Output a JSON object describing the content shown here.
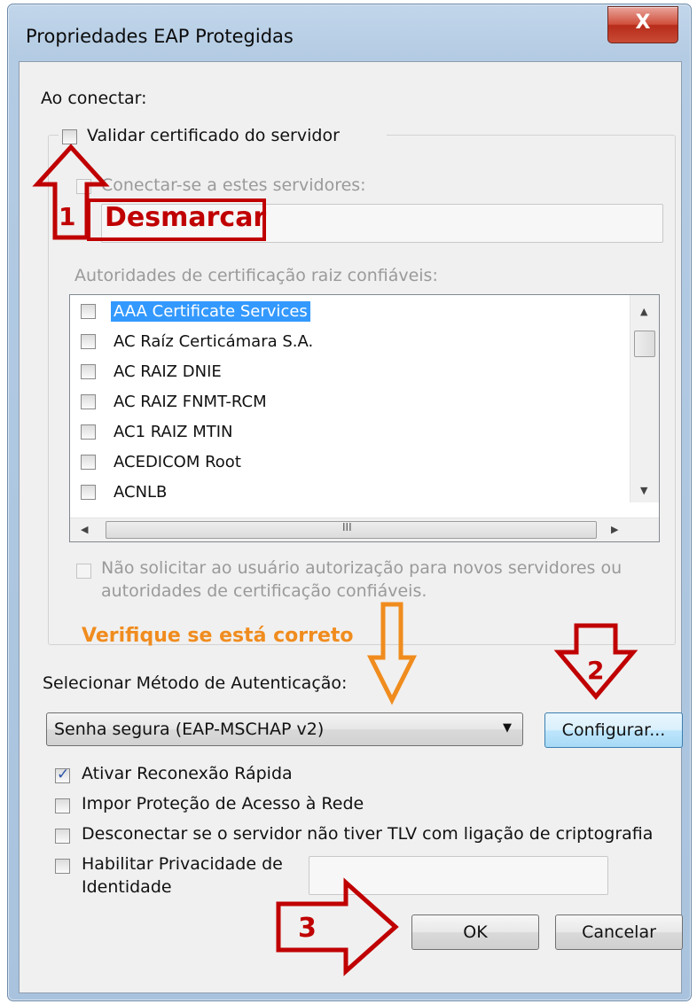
{
  "window": {
    "title": "Propriedades EAP Protegidas",
    "close_glyph": "X"
  },
  "connect": {
    "heading": "Ao conectar:",
    "validate_cert_label": "Validar certificado do servidor",
    "validate_cert_checked": false,
    "connect_servers_label": "Conectar-se a estes servidores:",
    "servers_value": "",
    "trusted_roots_label": "Autoridades de certificação raiz confiáveis:",
    "cert_list": [
      {
        "label": "AAA Certificate Services",
        "checked": false,
        "selected": true
      },
      {
        "label": "AC Raíz Certicámara S.A.",
        "checked": false,
        "selected": false
      },
      {
        "label": "AC RAIZ DNIE",
        "checked": false,
        "selected": false
      },
      {
        "label": "AC RAIZ FNMT-RCM",
        "checked": false,
        "selected": false
      },
      {
        "label": "AC1 RAIZ MTIN",
        "checked": false,
        "selected": false
      },
      {
        "label": "ACEDICOM Root",
        "checked": false,
        "selected": false
      },
      {
        "label": "ACNLB",
        "checked": false,
        "selected": false
      }
    ],
    "scroll_grip": "III",
    "no_prompt_label_line1": "Não solicitar ao usuário autorização para novos servidores ou",
    "no_prompt_label_line2": "autoridades de certificação confiáveis."
  },
  "auth": {
    "method_label": "Selecionar Método de Autenticação:",
    "method_value": "Senha segura (EAP-MSCHAP v2)",
    "configure_button": "Configurar..."
  },
  "options": {
    "fast_reconnect_label": "Ativar Reconexão Rápida",
    "fast_reconnect_checked": true,
    "nap_label": "Impor Proteção de Acesso à Rede",
    "nap_checked": false,
    "tlv_label": "Desconectar se o servidor não tiver TLV com ligação de criptografia",
    "tlv_checked": false,
    "identity_privacy_line1": "Habilitar Privacidade de",
    "identity_privacy_line2": "Identidade",
    "identity_privacy_checked": false,
    "identity_value": ""
  },
  "buttons": {
    "ok": "OK",
    "cancel": "Cancelar"
  },
  "annotations": {
    "step1_number": "1",
    "step1_text": "Desmarcar",
    "step2_number": "2",
    "step3_number": "3",
    "verify_text": "Verifique se está correto",
    "red_color": "#c00000",
    "orange_color": "#f08c1e"
  }
}
